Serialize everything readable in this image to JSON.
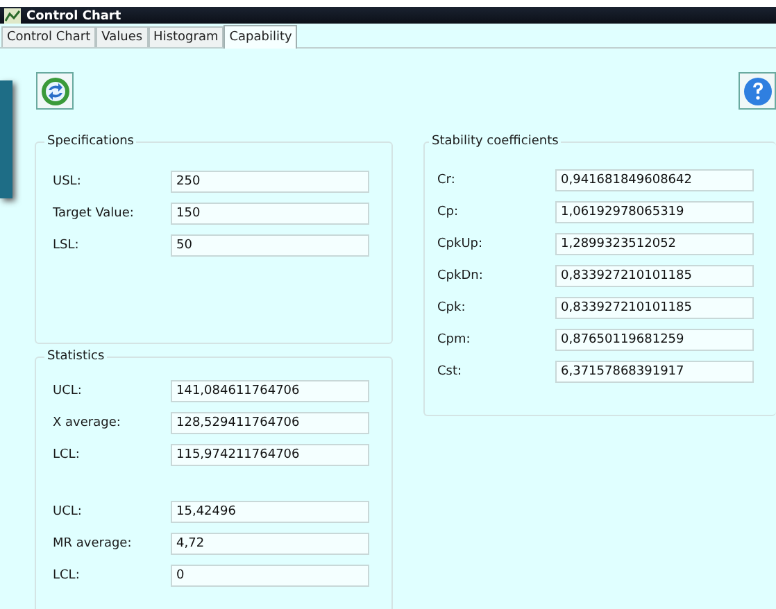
{
  "window": {
    "title": "Control Chart"
  },
  "tabs": [
    {
      "label": "Control Chart",
      "selected": false
    },
    {
      "label": "Values",
      "selected": false
    },
    {
      "label": "Histogram",
      "selected": false
    },
    {
      "label": "Capability",
      "selected": true
    }
  ],
  "specifications": {
    "title": "Specifications",
    "rows": [
      {
        "label": "USL:",
        "value": "250"
      },
      {
        "label": "Target Value:",
        "value": "150"
      },
      {
        "label": "LSL:",
        "value": "50"
      }
    ]
  },
  "statistics": {
    "title": "Statistics",
    "groups": [
      [
        {
          "label": "UCL:",
          "value": "141,084611764706"
        },
        {
          "label": "X average:",
          "value": "128,529411764706"
        },
        {
          "label": "LCL:",
          "value": "115,974211764706"
        }
      ],
      [
        {
          "label": "UCL:",
          "value": "15,42496"
        },
        {
          "label": "MR average:",
          "value": "4,72"
        },
        {
          "label": "LCL:",
          "value": "0"
        }
      ]
    ]
  },
  "stability_coefficients": {
    "title": "Stability coefficients",
    "rows": [
      {
        "label": "Cr:",
        "value": "0,941681849608642"
      },
      {
        "label": "Cp:",
        "value": "1,06192978065319"
      },
      {
        "label": "CpkUp:",
        "value": "1,2899323512052"
      },
      {
        "label": "CpkDn:",
        "value": "0,833927210101185"
      },
      {
        "label": "Cpk:",
        "value": "0,833927210101185"
      },
      {
        "label": "Cpm:",
        "value": "0,87650119681259"
      },
      {
        "label": "Cst:",
        "value": "6,37157868391917"
      }
    ]
  }
}
